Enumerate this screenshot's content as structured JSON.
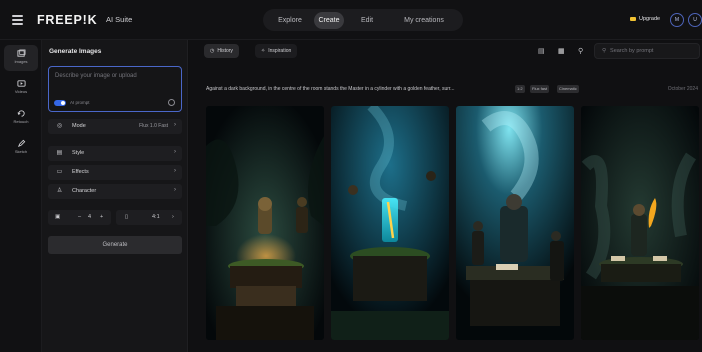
{
  "topbar": {
    "logo": "FREEP!K",
    "suite": "AI Suite",
    "nav": [
      "Explore",
      "Create",
      "Edit",
      "My creations"
    ],
    "active_nav": "Create",
    "upgrade": "Upgrade",
    "avatars": [
      "M",
      "U"
    ]
  },
  "rail": {
    "items": [
      {
        "label": "Images",
        "icon": "image-stack-icon"
      },
      {
        "label": "Videos",
        "icon": "video-icon"
      },
      {
        "label": "Retouch",
        "icon": "retouch-icon"
      },
      {
        "label": "Sketch",
        "icon": "pencil-icon"
      }
    ]
  },
  "panel": {
    "title": "Generate Images",
    "prompt_placeholder": "Describe your image or upload",
    "ai_prompt_label": "AI prompt",
    "mode_label": "Mode",
    "mode_value": "Flux 1.0 Fast",
    "style_label": "Style",
    "effects_label": "Effects",
    "character_label": "Character",
    "count_minus": "–",
    "count_value": "4",
    "count_plus": "+",
    "ratio_value": "4:1",
    "generate_label": "Generate"
  },
  "main": {
    "history_label": "History",
    "inspiration_label": "Inspiration",
    "search_placeholder": "Search by prompt",
    "prompt_text": "Against a dark background, in the centre of the room stands the Master in a cylinder with a golden feather, surr...",
    "tags": [
      "1:2",
      "Flux fast",
      "Cinematic"
    ],
    "date": "October 2024"
  },
  "colors": {
    "accent": "#3567e6",
    "upgrade": "#f1c232",
    "teal": "#1fd3c9"
  }
}
